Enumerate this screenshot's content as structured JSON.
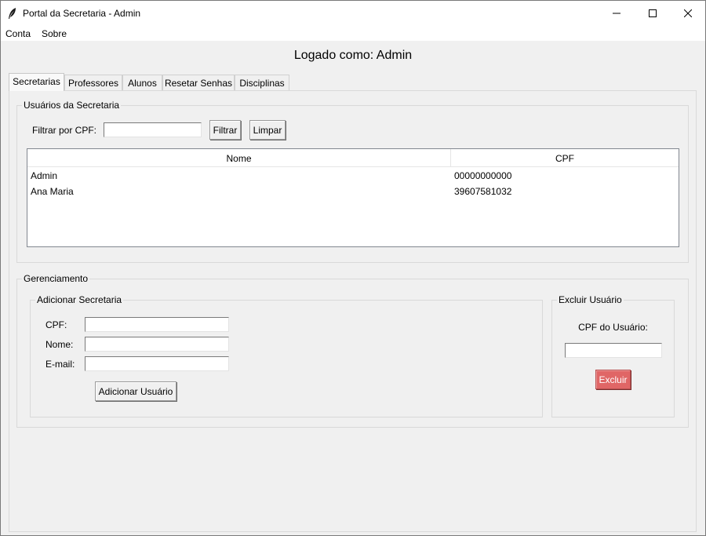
{
  "window": {
    "title": "Portal da Secretaria - Admin"
  },
  "menu": {
    "items": [
      "Conta",
      "Sobre"
    ]
  },
  "header": {
    "logged_in": "Logado como: Admin"
  },
  "tabs": [
    {
      "label": "Secretarias",
      "active": true
    },
    {
      "label": "Professores",
      "active": false
    },
    {
      "label": "Alunos",
      "active": false
    },
    {
      "label": "Resetar Senhas",
      "active": false
    },
    {
      "label": "Disciplinas",
      "active": false
    }
  ],
  "users_section": {
    "title": "Usuários da Secretaria",
    "filter_label": "Filtrar por CPF:",
    "filter_value": "",
    "filter_button": "Filtrar",
    "clear_button": "Limpar",
    "columns": [
      "Nome",
      "CPF"
    ],
    "rows": [
      {
        "nome": "Admin",
        "cpf": "00000000000"
      },
      {
        "nome": "Ana Maria",
        "cpf": "39607581032"
      }
    ]
  },
  "management": {
    "title": "Gerenciamento",
    "add": {
      "title": "Adicionar Secretaria",
      "cpf_label": "CPF:",
      "nome_label": "Nome:",
      "email_label": "E-mail:",
      "cpf_value": "",
      "nome_value": "",
      "email_value": "",
      "submit": "Adicionar Usuário"
    },
    "delete": {
      "title": "Excluir Usuário",
      "cpf_label": "CPF do Usuário:",
      "cpf_value": "",
      "submit": "Excluir"
    }
  },
  "colors": {
    "danger": "#e06666",
    "background": "#f0f0f0"
  }
}
